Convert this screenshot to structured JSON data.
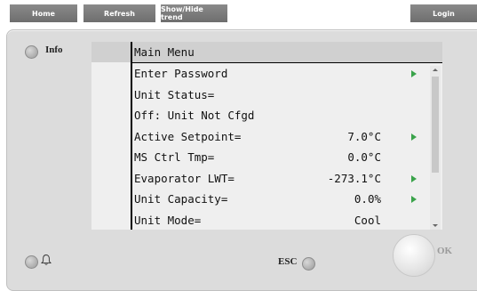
{
  "toolbar": {
    "home": "Home",
    "refresh": "Refresh",
    "show_hide_trend": "Show/Hide trend",
    "login": "Login"
  },
  "panel": {
    "info_label": "Info",
    "esc_label": "ESC",
    "ok_label": "OK"
  },
  "screen": {
    "title": "Main Menu",
    "rows": [
      {
        "label": "Enter Password",
        "value": "",
        "arrow": true
      },
      {
        "label": "Unit Status=",
        "value": "",
        "arrow": false
      },
      {
        "label": "Off: Unit Not Cfgd",
        "value": "",
        "arrow": false
      },
      {
        "label": "Active Setpoint=",
        "value": "7.0°C",
        "arrow": true
      },
      {
        "label": "MS Ctrl Tmp=",
        "value": "0.0°C",
        "arrow": false
      },
      {
        "label": "Evaporator LWT=",
        "value": "-273.1°C",
        "arrow": true
      },
      {
        "label": "Unit Capacity=",
        "value": "0.0%",
        "arrow": true
      },
      {
        "label": "Unit Mode=",
        "value": "Cool",
        "arrow": false
      }
    ]
  },
  "colors": {
    "arrow": "#3aa34a",
    "toolbar_button": "#7a7a7a",
    "panel": "#dcdcdc",
    "screen": "#efefef"
  }
}
